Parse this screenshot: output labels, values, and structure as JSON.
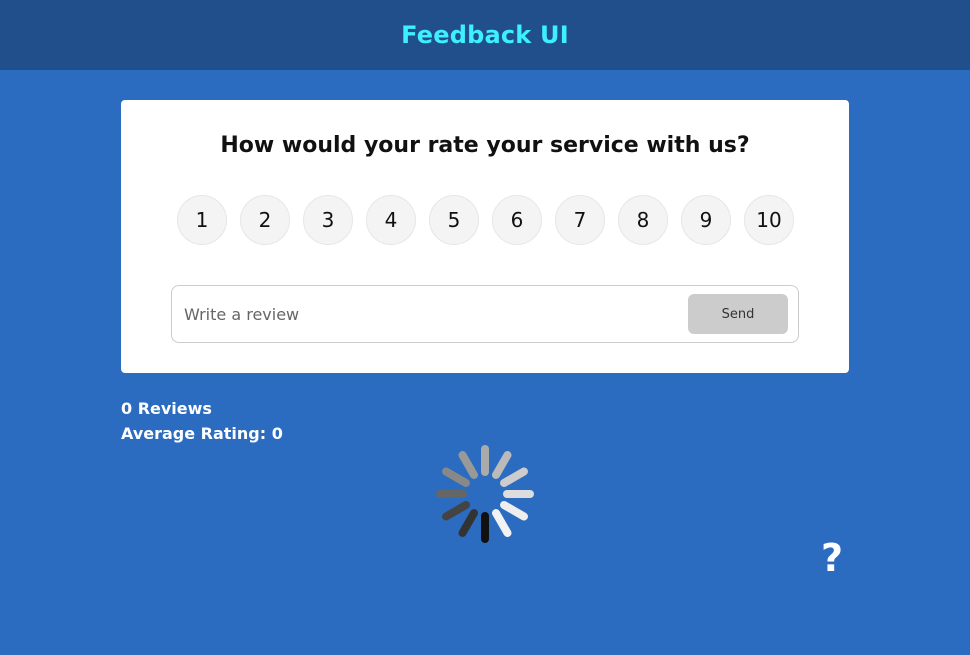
{
  "header": {
    "title": "Feedback UI"
  },
  "card": {
    "question": "How would your rate your service with us?",
    "ratings": [
      "1",
      "2",
      "3",
      "4",
      "5",
      "6",
      "7",
      "8",
      "9",
      "10"
    ],
    "review": {
      "placeholder": "Write a review",
      "value": ""
    },
    "send_label": "Send"
  },
  "stats": {
    "reviews_text": "0 Reviews",
    "average_text": "Average Rating: 0"
  },
  "help": {
    "label": "?"
  },
  "colors": {
    "background": "#2c6cc0",
    "header_bg": "#214f8c",
    "title": "#3ef0ff",
    "button_bg": "#cccccc"
  }
}
